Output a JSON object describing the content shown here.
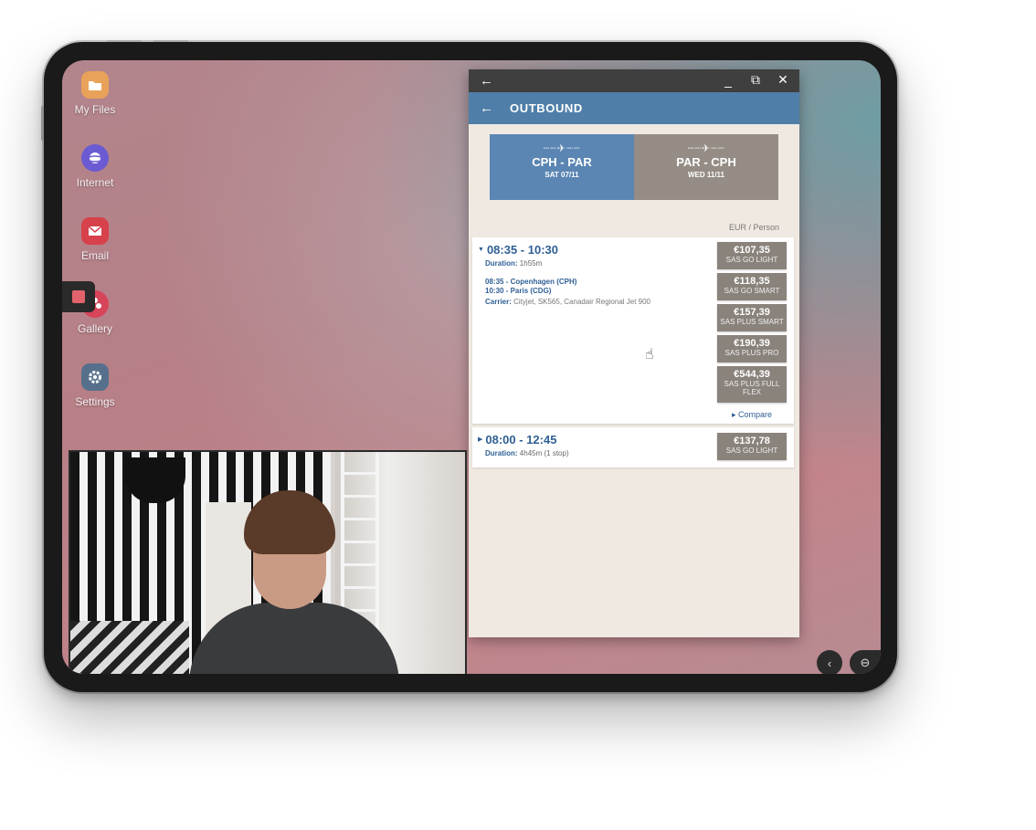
{
  "desktop": {
    "icons": [
      {
        "label": "My Files",
        "icon": "folder-icon",
        "color": "#e9a25a"
      },
      {
        "label": "Internet",
        "icon": "planet-icon",
        "color": "#6b5bd2"
      },
      {
        "label": "Email",
        "icon": "envelope-icon",
        "color": "#d7414b"
      },
      {
        "label": "Gallery",
        "icon": "flower-icon",
        "color": "#d8455a"
      },
      {
        "label": "Settings",
        "icon": "gear-icon",
        "color": "#56708c"
      }
    ]
  },
  "window": {
    "titlebar": {
      "back": "←",
      "minimize": "_",
      "maximize": "⧉",
      "close": "✕"
    },
    "header": {
      "back": "←",
      "title": "OUTBOUND"
    },
    "trips": [
      {
        "plane": "┈┈✈┈┈",
        "route": "CPH - PAR",
        "date": "SAT 07/11",
        "active": true
      },
      {
        "plane": "┈┈✈┈┈",
        "route": "PAR - CPH",
        "date": "WED 11/11",
        "active": false
      }
    ],
    "unit_note": "EUR / Person",
    "flights": [
      {
        "time": "08:35 - 10:30",
        "duration_label": "Duration:",
        "duration": "1h55m",
        "segments": [
          "08:35 - Copenhagen (CPH)",
          "10:30 - Paris (CDG)"
        ],
        "carrier_label": "Carrier:",
        "carrier": "Cityjet, SK565, Canadair Regional Jet 900",
        "fares": [
          {
            "price": "€107,35",
            "name": "SAS GO LIGHT"
          },
          {
            "price": "€118,35",
            "name": "SAS GO SMART"
          },
          {
            "price": "€157,39",
            "name": "SAS PLUS SMART"
          },
          {
            "price": "€190,39",
            "name": "SAS PLUS PRO"
          },
          {
            "price": "€544,39",
            "name": "SAS PLUS FULL FLEX"
          }
        ],
        "compare": "Compare"
      },
      {
        "time": "08:00 - 12:45",
        "duration_label": "Duration:",
        "duration": "4h45m (1 stop)",
        "fares": [
          {
            "price": "€137,78",
            "name": "SAS GO LIGHT"
          }
        ]
      }
    ]
  },
  "nav": {
    "back": "‹",
    "minimize": "⊖"
  },
  "colors": {
    "header_blue": "#4f7fa9",
    "active_tab": "#5b86b4",
    "inactive_tab": "#958d85",
    "fare_bg": "#8a837c",
    "time_blue": "#2f5f94"
  }
}
